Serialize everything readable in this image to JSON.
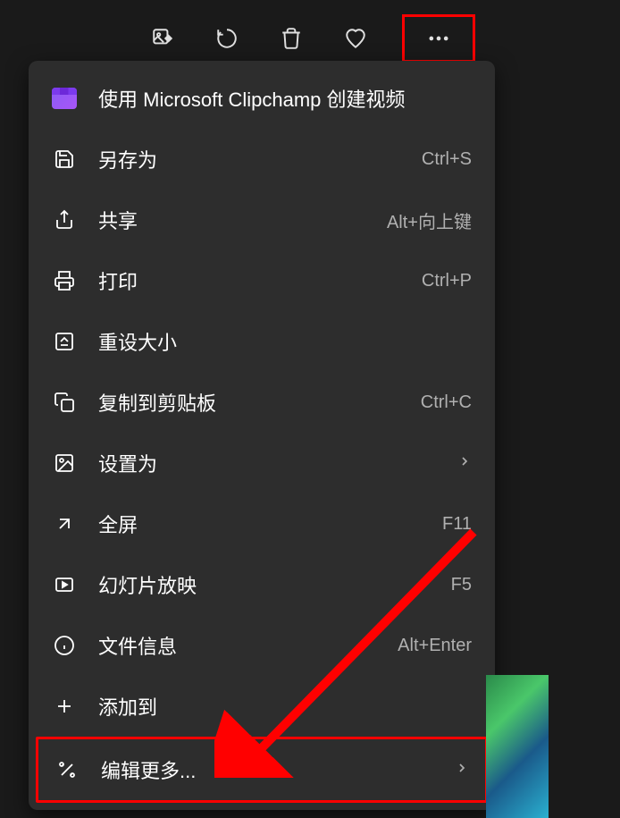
{
  "toolbar": {
    "edit_image": "edit-image",
    "rotate": "rotate",
    "delete": "delete",
    "favorite": "favorite",
    "more": "more"
  },
  "menu": {
    "items": [
      {
        "icon": "clipchamp",
        "label": "使用 Microsoft Clipchamp 创建视频",
        "shortcut": "",
        "submenu": false
      },
      {
        "icon": "save",
        "label": "另存为",
        "shortcut": "Ctrl+S",
        "submenu": false
      },
      {
        "icon": "share",
        "label": "共享",
        "shortcut": "Alt+向上键",
        "submenu": false
      },
      {
        "icon": "print",
        "label": "打印",
        "shortcut": "Ctrl+P",
        "submenu": false
      },
      {
        "icon": "resize",
        "label": "重设大小",
        "shortcut": "",
        "submenu": false
      },
      {
        "icon": "copy",
        "label": "复制到剪贴板",
        "shortcut": "Ctrl+C",
        "submenu": false
      },
      {
        "icon": "set-as",
        "label": "设置为",
        "shortcut": "",
        "submenu": true
      },
      {
        "icon": "fullscreen",
        "label": "全屏",
        "shortcut": "F11",
        "submenu": false
      },
      {
        "icon": "slideshow",
        "label": "幻灯片放映",
        "shortcut": "F5",
        "submenu": false
      },
      {
        "icon": "info",
        "label": "文件信息",
        "shortcut": "Alt+Enter",
        "submenu": false
      },
      {
        "icon": "add",
        "label": "添加到",
        "shortcut": "",
        "submenu": false
      },
      {
        "icon": "edit",
        "label": "编辑更多...",
        "shortcut": "",
        "submenu": true
      }
    ]
  }
}
